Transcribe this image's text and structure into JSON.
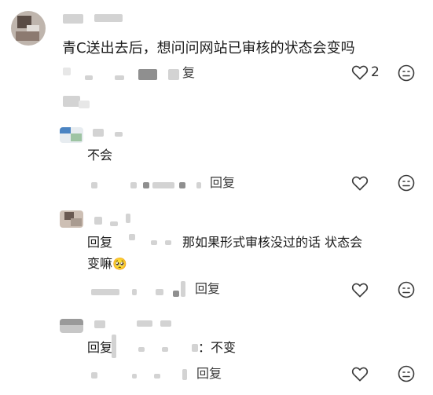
{
  "comments": [
    {
      "text": "青C送出去后，想问问网站已审核的状态会变吗",
      "reply_label": "复",
      "like_count": "2"
    }
  ],
  "replies": [
    {
      "text": "不会",
      "reply_label": "回复"
    },
    {
      "reply_prefix": "回复",
      "text": "那如果形式审核没过的话 状态会",
      "text_line2": "变嘛",
      "emoji": "🥺",
      "reply_label": "回复"
    },
    {
      "reply_prefix": "回复",
      "text": "：不变",
      "reply_label": "回复"
    }
  ],
  "icons": {
    "like": "heart-outline-icon",
    "dislike": "frown-face-icon"
  }
}
